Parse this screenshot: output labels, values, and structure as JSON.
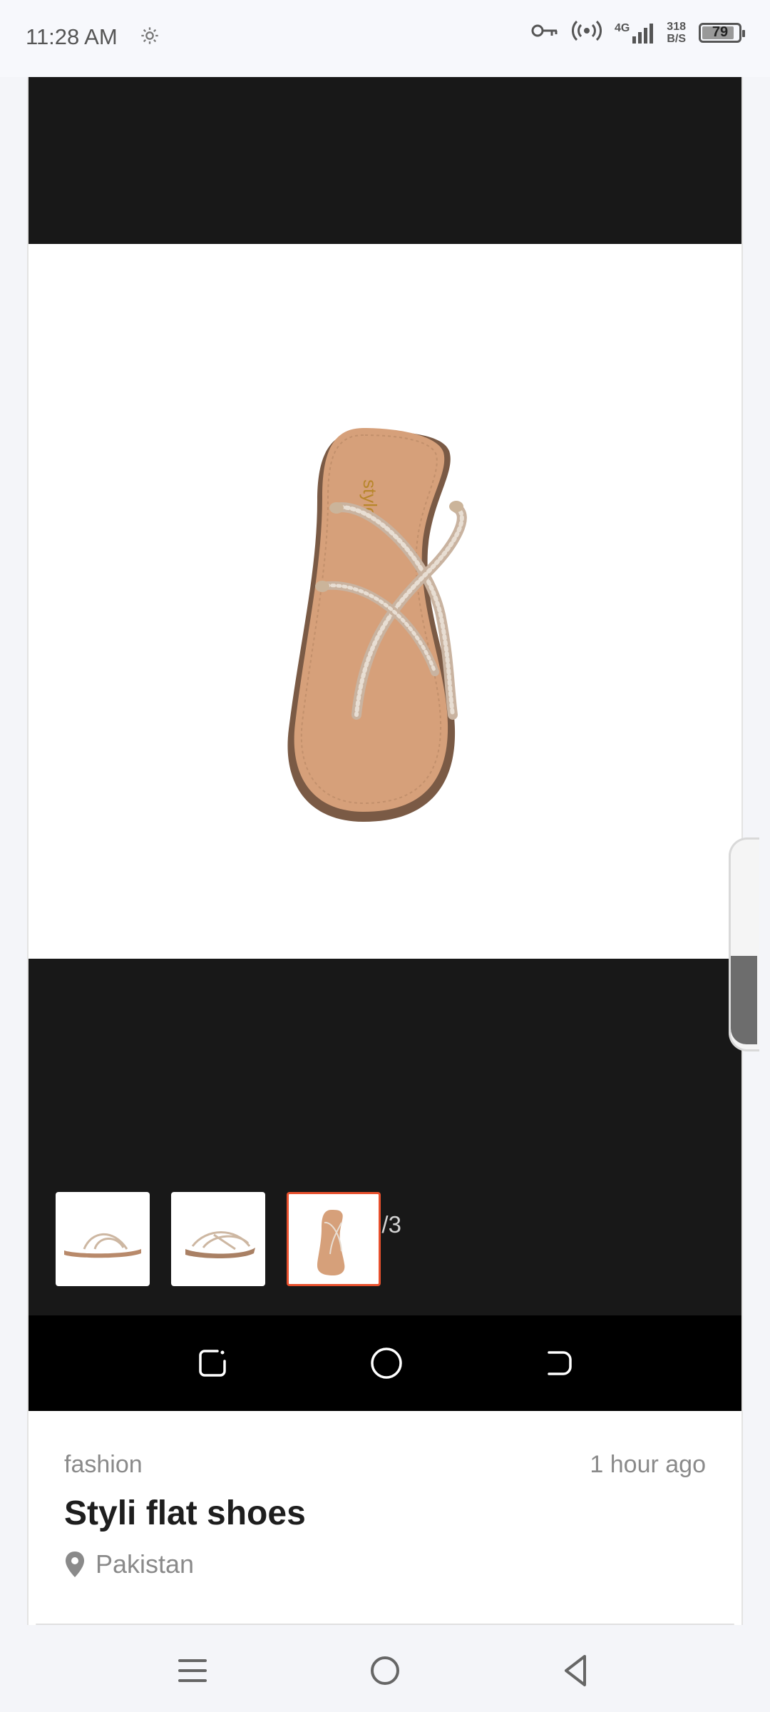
{
  "status_bar": {
    "time": "11:28 AM",
    "network_type": "4G",
    "net_speed_value": "318",
    "net_speed_unit": "B/S",
    "battery": "79",
    "icons": [
      "settings-gear-icon",
      "vpn-key-icon",
      "hotspot-icon",
      "signal-icon",
      "battery-icon"
    ]
  },
  "gallery": {
    "counter": "3/3",
    "selected_index": 3,
    "thumbnails": [
      {
        "name": "sandal-side-view"
      },
      {
        "name": "sandal-angle-view"
      },
      {
        "name": "sandal-top-view"
      }
    ],
    "sandal_brand_text": "stylo"
  },
  "listing": {
    "category": "fashion",
    "posted": "1 hour ago",
    "title": "Styli flat shoes",
    "location": "Pakistan"
  },
  "colors": {
    "accent": "#e8502d",
    "viewer_bg": "#181818",
    "text_muted": "#8a8a8a"
  }
}
